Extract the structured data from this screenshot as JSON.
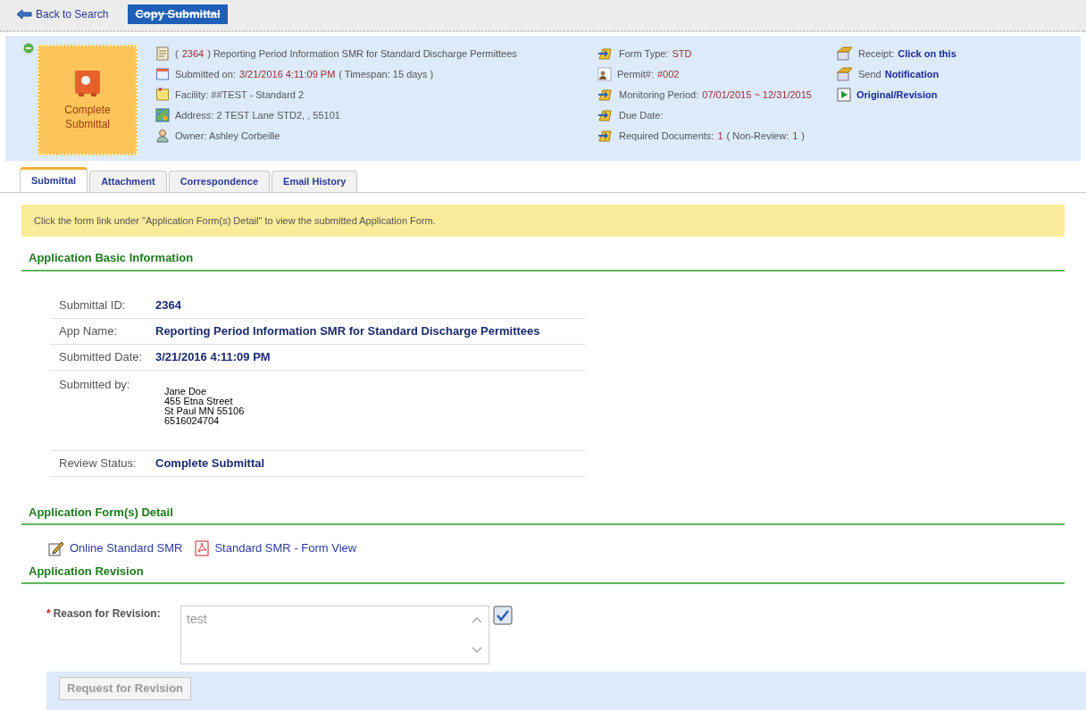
{
  "toolbar": {
    "back_link": "Back to Search",
    "copy_button": "Copy Submittal"
  },
  "header": {
    "status_badge": "Complete Submittal",
    "column_1": [
      {
        "segments": [
          {
            "kind": "plain",
            "text": "("
          },
          {
            "kind": "value",
            "text": "2364"
          },
          {
            "kind": "plain",
            "text": ") Reporting Period Information SMR for Standard Discharge Permittees"
          }
        ]
      },
      {
        "segments": [
          {
            "kind": "plain",
            "text": "Submitted on:"
          },
          {
            "kind": "value",
            "text": "3/21/2016 4:11:09 PM"
          },
          {
            "kind": "plain",
            "text": "( Timespan: 15 days )"
          }
        ]
      },
      {
        "segments": [
          {
            "kind": "plain",
            "text": "Facility: ##TEST - Standard 2"
          }
        ]
      },
      {
        "segments": [
          {
            "kind": "plain",
            "text": "Address: 2 TEST Lane STD2, , 55101"
          }
        ]
      },
      {
        "segments": [
          {
            "kind": "plain",
            "text": "Owner: Ashley Corbeille"
          }
        ]
      }
    ],
    "column_2": [
      {
        "segments": [
          {
            "kind": "plain",
            "text": "Form Type:"
          },
          {
            "kind": "value",
            "text": "STD"
          }
        ]
      },
      {
        "segments": [
          {
            "kind": "plain",
            "text": "Permit#:"
          },
          {
            "kind": "value",
            "text": "#002"
          }
        ]
      },
      {
        "segments": [
          {
            "kind": "plain",
            "text": "Monitoring Period:"
          },
          {
            "kind": "value",
            "text": "07/01/2015 ~ 12/31/2015"
          }
        ]
      },
      {
        "segments": [
          {
            "kind": "plain",
            "text": "Due Date:"
          }
        ]
      },
      {
        "segments": [
          {
            "kind": "plain",
            "text": "Required Documents:"
          },
          {
            "kind": "value",
            "text": "1"
          },
          {
            "kind": "plain",
            "text": "( Non-Review:"
          },
          {
            "kind": "value",
            "text": "1"
          },
          {
            "kind": "plain",
            "text": ")"
          }
        ]
      }
    ],
    "column_3": [
      {
        "segments": [
          {
            "kind": "plain",
            "text": "Receipt:"
          },
          {
            "kind": "link",
            "text": "Click on this"
          }
        ]
      },
      {
        "segments": [
          {
            "kind": "plain",
            "text": "Send"
          },
          {
            "kind": "link",
            "text": "Notification"
          }
        ]
      },
      {
        "segments": [
          {
            "kind": "link",
            "text": "Original/Revision"
          }
        ]
      }
    ]
  },
  "tabs": [
    {
      "label": "Submittal",
      "selected": true
    },
    {
      "label": "Attachment",
      "selected": false
    },
    {
      "label": "Correspondence",
      "selected": false
    },
    {
      "label": "Email History",
      "selected": false
    }
  ],
  "notice": "Click the form link under \"Application Form(s) Detail\" to view the submitted Application Form.",
  "basic_info": {
    "title": "Application Basic Information",
    "rows": [
      {
        "label": "Submittal ID:",
        "kind": "value",
        "value": "2364"
      },
      {
        "label": "App Name:",
        "kind": "value",
        "value": "Reporting Period Information SMR for Standard Discharge Permittees"
      },
      {
        "label": "Submitted Date:",
        "kind": "value",
        "value": "3/21/2016 4:11:09 PM"
      },
      {
        "label": "Submitted by:",
        "kind": "address",
        "lines": [
          "Jane Doe",
          "455 Etna Street",
          "St Paul MN 55106",
          "6516024704"
        ]
      },
      {
        "label": "Review Status:",
        "kind": "value",
        "value": "Complete Submittal"
      }
    ]
  },
  "forms": {
    "title": "Application Form(s) Detail",
    "links": [
      {
        "kind": "online",
        "label": "Online Standard SMR"
      },
      {
        "kind": "pdf",
        "label": "Standard SMR - Form View"
      }
    ]
  },
  "revision": {
    "title": "Application Revision",
    "required_mark": "*",
    "label": "Reason for Revision:",
    "value": "test",
    "button": "Request for Revision",
    "button_disabled": true
  }
}
